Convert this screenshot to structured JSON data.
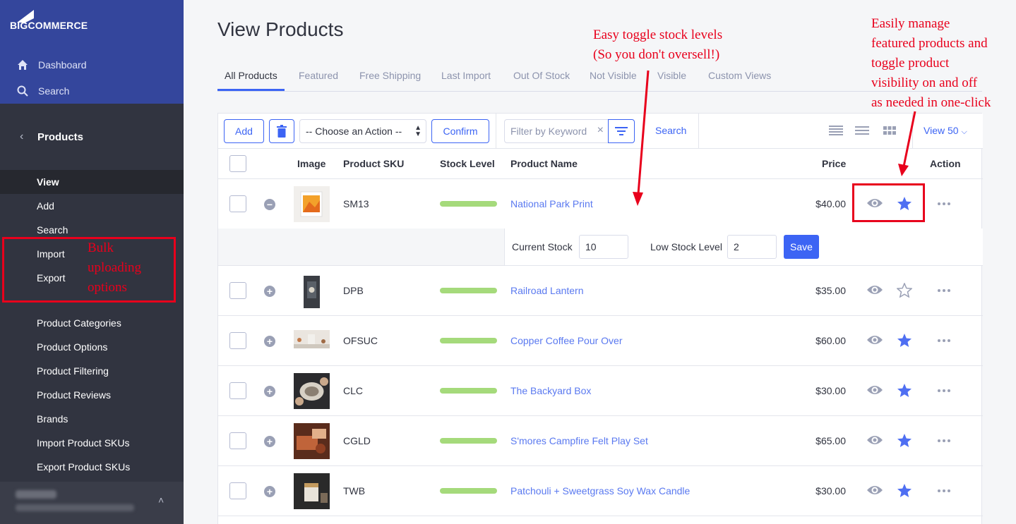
{
  "brand": {
    "logo_text": "BIGCOMMERCE",
    "accent": "#3c64f4",
    "sidebar_top": "#34469c",
    "sidebar": "#313440",
    "link": "#5a79f0",
    "stock_bar": "#a5da7b",
    "annotation": "#e8001c"
  },
  "sidebar": {
    "top_links": [
      {
        "label": "Dashboard",
        "icon": "home-icon"
      },
      {
        "label": "Search",
        "icon": "search-icon"
      }
    ],
    "section": "Products",
    "items": [
      {
        "label": "View",
        "active": true
      },
      {
        "label": "Add"
      },
      {
        "label": "Search"
      },
      {
        "label": "Import"
      },
      {
        "label": "Export"
      },
      {
        "label": "Product Categories"
      },
      {
        "label": "Product Options"
      },
      {
        "label": "Product Filtering"
      },
      {
        "label": "Product Reviews"
      },
      {
        "label": "Brands"
      },
      {
        "label": "Import Product SKUs"
      },
      {
        "label": "Export Product SKUs"
      }
    ]
  },
  "page": {
    "title": "View Products"
  },
  "tabs": [
    "All Products",
    "Featured",
    "Free Shipping",
    "Last Import",
    "Out Of Stock",
    "Not Visible",
    "Visible",
    "Custom Views"
  ],
  "toolbar": {
    "add_label": "Add",
    "action_select": "-- Choose an Action --",
    "confirm_label": "Confirm",
    "filter_placeholder": "Filter by Keyword",
    "search_label": "Search",
    "view_label": "View 50"
  },
  "table": {
    "columns": {
      "image": "Image",
      "sku": "Product SKU",
      "stock": "Stock Level",
      "name": "Product Name",
      "price": "Price",
      "action": "Action"
    },
    "rows": [
      {
        "sku": "SM13",
        "name": "National Park Print",
        "price": "$40.00",
        "featured": true,
        "expanded": true
      },
      {
        "sku": "DPB",
        "name": "Railroad Lantern",
        "price": "$35.00",
        "featured": false
      },
      {
        "sku": "OFSUC",
        "name": "Copper Coffee Pour Over",
        "price": "$60.00",
        "featured": true
      },
      {
        "sku": "CLC",
        "name": "The Backyard Box",
        "price": "$30.00",
        "featured": true
      },
      {
        "sku": "CGLD",
        "name": "S'mores Campfire Felt Play Set",
        "price": "$65.00",
        "featured": true
      },
      {
        "sku": "TWB",
        "name": "Patchouli + Sweetgrass Soy Wax Candle",
        "price": "$30.00",
        "featured": true
      }
    ],
    "stock_editor": {
      "current_label": "Current Stock",
      "current_value": "10",
      "low_label": "Low Stock Level",
      "low_value": "2",
      "save_label": "Save"
    }
  },
  "annotations": {
    "stock": [
      "Easy toggle stock levels",
      "(So you don't oversell!)"
    ],
    "featured": [
      "Easily manage",
      "featured products and",
      "toggle product",
      "visibility on and off",
      "as needed in one-click"
    ],
    "bulk": [
      "Bulk",
      "uploading",
      "options"
    ]
  }
}
